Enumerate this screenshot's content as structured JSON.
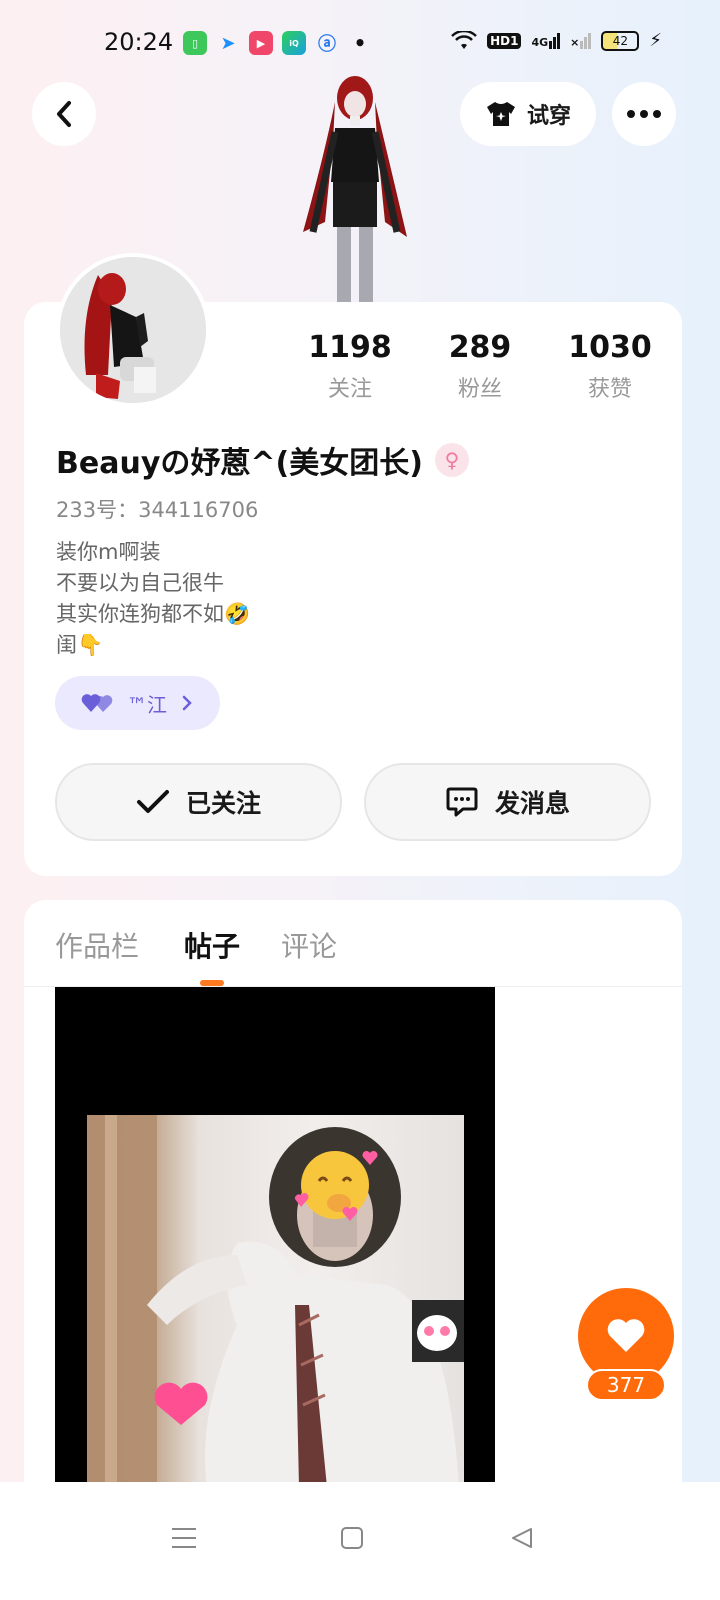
{
  "status_bar": {
    "time": "20:24",
    "icons": [
      "wechat-icon",
      "arrow-app-icon",
      "video-app-icon",
      "iqiyi-icon",
      "browser-icon",
      "dot-icon"
    ],
    "right_icons": [
      "wifi-icon",
      "hd-icon",
      "4g-signal-icon",
      "signal-x-icon"
    ],
    "hd_label": "HD1",
    "net_label": "4G",
    "battery": "42",
    "battery_level": 0.42
  },
  "header": {
    "back_icon": "chevron-left-icon",
    "try_on_label": "试穿",
    "more_icon": "more-dots-icon"
  },
  "stats": [
    {
      "value": "1198",
      "label": "关注"
    },
    {
      "value": "289",
      "label": "粉丝"
    },
    {
      "value": "1030",
      "label": "获赞"
    }
  ],
  "profile": {
    "username": "Beauyの妤蒽^(美女团长)",
    "gender_symbol": "♀",
    "user_id": "233号：344116706",
    "bio_lines": [
      "装你m啊装",
      "不要以为自己很牛",
      "其实你连狗都不如🤣",
      "闺👇"
    ],
    "fan_group_label": "™江"
  },
  "actions": {
    "follow_label": "已关注",
    "message_label": "发消息"
  },
  "tabs": [
    {
      "label": "作品栏",
      "active": false
    },
    {
      "label": "帖子",
      "active": true
    },
    {
      "label": "评论",
      "active": false
    }
  ],
  "like": {
    "count": "377"
  },
  "colors": {
    "accent": "#ff6b0a",
    "fan_pill_bg": "#ebe9fd",
    "fan_pill_fg": "#6a5fd8",
    "gender_pink": "#f07b9b"
  }
}
